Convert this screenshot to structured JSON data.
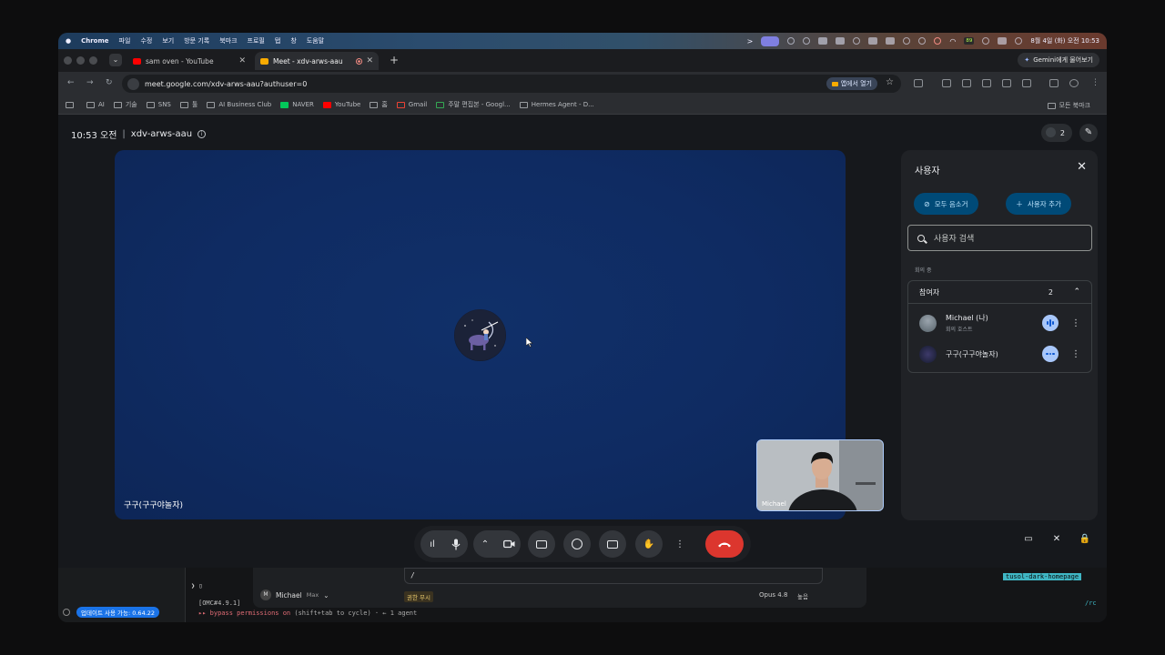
{
  "menubar": {
    "app": "Chrome",
    "items": [
      "파일",
      "수정",
      "보기",
      "방문 기록",
      "북마크",
      "프로필",
      "탭",
      "창",
      "도움말"
    ],
    "battery": "89",
    "datetime": "8월 4일 (화) 오전 10:53"
  },
  "tabs": [
    {
      "title": "sam oven - YouTube",
      "favicon": "youtube-icon",
      "color": "#ff0000"
    },
    {
      "title": "Meet - xdv-arws-aau",
      "favicon": "meet-icon",
      "color": "#f9ab00"
    }
  ],
  "gemini": {
    "label": "Gemini에게 물어보기"
  },
  "omnibox": {
    "url": "meet.google.com/xdv-arws-aau?authuser=0",
    "open_in_app": "앱에서 열기"
  },
  "bookmarks": {
    "items": [
      "AI",
      "기술",
      "SNS",
      "툴",
      "AI Business Club",
      "NAVER",
      "YouTube",
      "홈",
      "Gmail",
      "주말 편집본 - Googl...",
      "Hermes Agent - D..."
    ],
    "all": "모든 북마크"
  },
  "meet": {
    "time": "10:53 오전",
    "meeting_code": "xdv-arws-aau",
    "people_count": "2",
    "main_tile_name": "구구(구구야놀자)",
    "self_tile_name": "Michael"
  },
  "people_panel": {
    "title": "사용자",
    "mute_all": "모두 음소거",
    "add_people": "사용자 추가",
    "search_placeholder": "사용자 검색",
    "section": "회의 중",
    "participants_label": "참여자",
    "participants_count": "2",
    "participants": [
      {
        "name": "Michael (나)",
        "role": "회의 호스트",
        "status": "speaking"
      },
      {
        "name": "구구(구구야놀자)",
        "role": "",
        "status": "more"
      }
    ]
  },
  "lower": {
    "update": "업데이트 사용 가능: 0.64.22",
    "account_name": "Michael",
    "account_plan": "Max",
    "input_text": "/",
    "permission_label": "권한 무시",
    "model": "Opus 4.8",
    "effort": "높음",
    "branch": "tusol-dark-homepage",
    "version_line": "[OMC#4.9.1]",
    "bypass_main": "▸▸ bypass permissions on",
    "bypass_rest": "(shift+tab to cycle) · ← 1 agent",
    "rc": "/rc"
  },
  "colors": {
    "stage_blue": "#0f2b62",
    "end_call_red": "#dc362e",
    "panel_button": "#004a77",
    "speaking_badge": "#a8c7fa"
  }
}
